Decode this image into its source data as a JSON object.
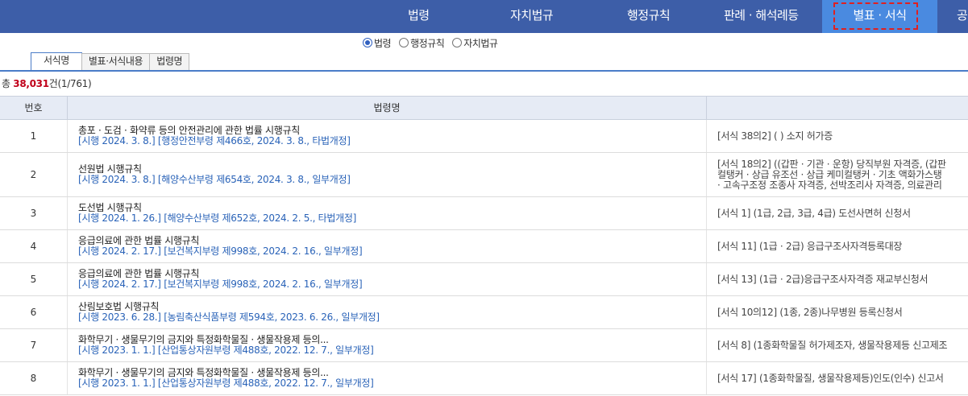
{
  "nav": {
    "items": [
      "법령",
      "자치법규",
      "행정규칙",
      "판례 · 해석례등",
      "별표 · 서식",
      "공"
    ]
  },
  "radio": {
    "options": [
      "법령",
      "행정규칙",
      "자치법규"
    ]
  },
  "tabs": [
    "서식명",
    "별표·서식내용",
    "법령명"
  ],
  "count": {
    "prefix": "총 ",
    "number": "38,031",
    "suffix": "건(1/761)"
  },
  "table": {
    "headers": [
      "번호",
      "법령명",
      ""
    ],
    "rows": [
      {
        "no": "1",
        "law": "총포 · 도검 · 화약류 등의 안전관리에 관한 법률 시행규칙",
        "sub": "[시행 2024. 3. 8.] [행정안전부령 제466호, 2024. 3. 8., 타법개정]",
        "form": [
          "[서식 38의2] ( ) 소지 허가증"
        ]
      },
      {
        "no": "2",
        "law": "선원법 시행규칙",
        "sub": "[시행 2024. 3. 8.] [해양수산부령 제654호, 2024. 3. 8., 일부개정]",
        "form": [
          "[서식 18의2] ((갑판 · 기관 · 운항) 당직부원 자격증, (갑판",
          "컬탱커 · 상급 유조선 · 상급 케미컬탱커 · 기초 액화가스탱",
          " · 고속구조정 조종사 자격증, 선박조리사 자격증, 의료관리"
        ]
      },
      {
        "no": "3",
        "law": "도선법 시행규칙",
        "sub": "[시행 2024. 1. 26.] [해양수산부령 제652호, 2024. 2. 5., 타법개정]",
        "form": [
          "[서식 1] (1급, 2급, 3급, 4급) 도선사면허 신청서"
        ]
      },
      {
        "no": "4",
        "law": "응급의료에 관한 법률 시행규칙",
        "sub": "[시행 2024. 2. 17.] [보건복지부령 제998호, 2024. 2. 16., 일부개정]",
        "form": [
          "[서식 11] (1급 · 2급) 응급구조사자격등록대장"
        ]
      },
      {
        "no": "5",
        "law": "응급의료에 관한 법률 시행규칙",
        "sub": "[시행 2024. 2. 17.] [보건복지부령 제998호, 2024. 2. 16., 일부개정]",
        "form": [
          "[서식 13] (1급 · 2급)응급구조사자격증 재교부신청서"
        ]
      },
      {
        "no": "6",
        "law": "산림보호법 시행규칙",
        "sub": "[시행 2023. 6. 28.] [농림축산식품부령 제594호, 2023. 6. 26., 일부개정]",
        "form": [
          "[서식 10의12] (1종, 2종)나무병원 등록신청서"
        ]
      },
      {
        "no": "7",
        "law": "화학무기 · 생물무기의 금지와 특정화학물질 · 생물작용제 등의...",
        "sub": "[시행 2023. 1. 1.] [산업통상자원부령 제488호, 2022. 12. 7., 일부개정]",
        "form": [
          "[서식 8] (1종화학물질 허가제조자, 생물작용제등 신고제조"
        ]
      },
      {
        "no": "8",
        "law": "화학무기 · 생물무기의 금지와 특정화학물질 · 생물작용제 등의...",
        "sub": "[시행 2023. 1. 1.] [산업통상자원부령 제488호, 2022. 12. 7., 일부개정]",
        "form": [
          "[서식 17] (1종화학물질, 생물작용제등)인도(인수) 신고서"
        ]
      }
    ]
  }
}
